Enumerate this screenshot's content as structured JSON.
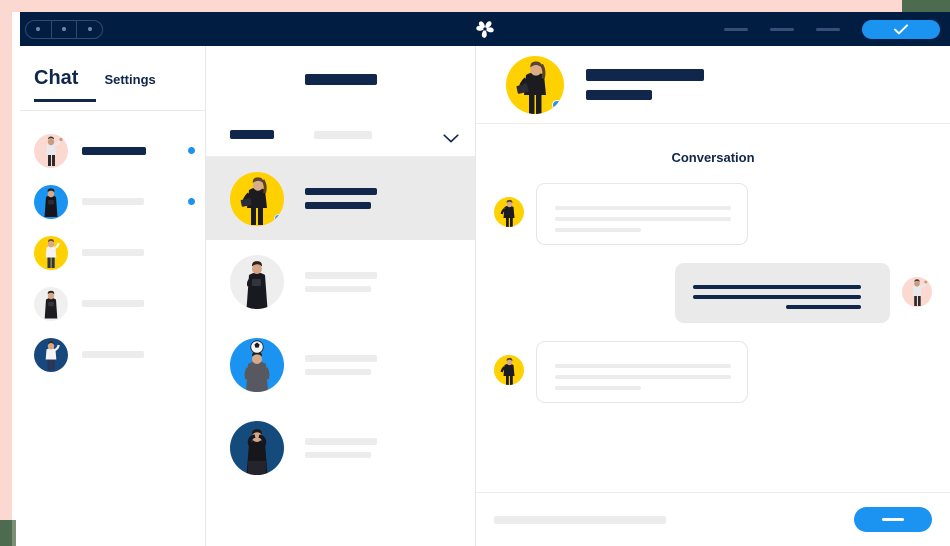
{
  "window": {
    "title": "Chat App Mockup",
    "topbar": {
      "window_controls": [
        "dot",
        "dot",
        "dot"
      ],
      "logo_icon": "pinwheel-logo-icon",
      "nav_placeholders": [
        "nav-line-1",
        "nav-line-2",
        "nav-line-3"
      ],
      "cta": {
        "icon": "check-icon",
        "label": ""
      },
      "bg_color": "#021d42",
      "accent_color": "#1a94f0"
    }
  },
  "sidebar": {
    "tabs": [
      {
        "label": "Chat",
        "active": true
      },
      {
        "label": "Settings",
        "active": false
      }
    ],
    "contacts": [
      {
        "avatar_color": "#fbd9d1",
        "name_style": "dark",
        "unread": true
      },
      {
        "avatar_color": "#1a94f0",
        "name_style": "gray",
        "unread": true
      },
      {
        "avatar_color": "#ffd100",
        "name_style": "gray",
        "unread": false
      },
      {
        "avatar_color": "#f0f0f0",
        "name_style": "gray",
        "unread": false
      },
      {
        "avatar_color": "#16487e",
        "name_style": "gray",
        "unread": false
      }
    ]
  },
  "list": {
    "header_placeholder": "title-bar",
    "filter": {
      "label_placeholder": "filter-label",
      "value_placeholder": "filter-value",
      "icon": "chevron-down-icon"
    },
    "conversations": [
      {
        "avatar_color": "#ffd100",
        "selected": true,
        "online": true,
        "lines": [
          "dark",
          "dark"
        ]
      },
      {
        "avatar_color": "#eeeeee",
        "selected": false,
        "online": false,
        "lines": [
          "gray",
          "gray"
        ]
      },
      {
        "avatar_color": "#1a94f0",
        "selected": false,
        "online": false,
        "lines": [
          "gray",
          "gray"
        ]
      },
      {
        "avatar_color": "#154a7d",
        "selected": false,
        "online": false,
        "lines": [
          "gray",
          "gray"
        ]
      }
    ]
  },
  "chat": {
    "header": {
      "avatar_color": "#ffd100",
      "online": true,
      "name_placeholder": "contact-name",
      "status_placeholder": "contact-status"
    },
    "title": "Conversation",
    "messages": [
      {
        "direction": "in",
        "avatar_color": "#ffd100",
        "line_widths": [
          176,
          176,
          86
        ],
        "line_style": "gray"
      },
      {
        "direction": "out",
        "avatar_color": "#fbd9d1",
        "line_widths": [
          168,
          168,
          75
        ],
        "line_style": "dark"
      },
      {
        "direction": "in",
        "avatar_color": "#ffd100",
        "line_widths": [
          176,
          176,
          86
        ],
        "line_style": "gray"
      }
    ],
    "composer": {
      "input_placeholder": "message-input",
      "send_label": "",
      "send_icon": "send-dash-icon"
    }
  },
  "colors": {
    "navy": "#10264a",
    "topbar": "#021d42",
    "blue": "#1a94f0",
    "yellow": "#ffd100",
    "pink": "#fbd9d1",
    "gray_bar": "#ececec",
    "selected_row": "#ebeaea",
    "frame_pink": "#fbd9d1",
    "frame_green": "#4d6b4e"
  }
}
